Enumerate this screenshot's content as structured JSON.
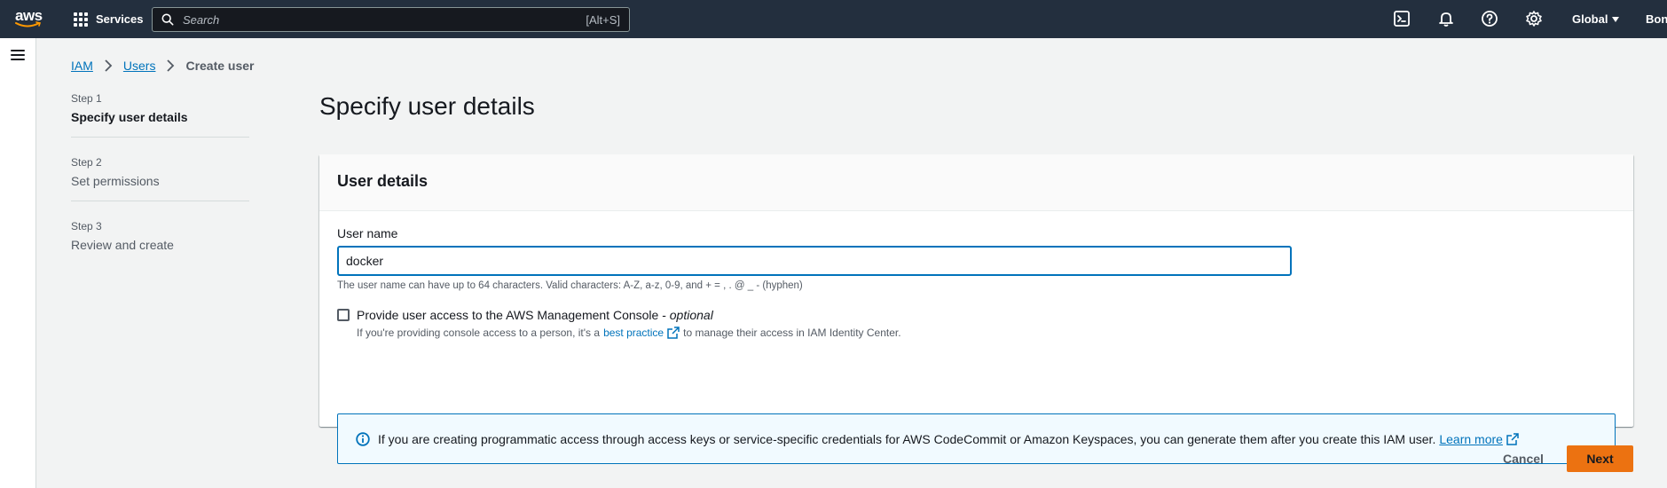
{
  "topnav": {
    "logo_text": "aws",
    "services_label": "Services",
    "search_placeholder": "Search",
    "search_shortcut": "[Alt+S]",
    "icons": [
      "cloudshell-icon",
      "notifications-icon",
      "help-icon",
      "settings-icon"
    ],
    "region_label": "Global",
    "account_label": "Bon"
  },
  "breadcrumb": {
    "items": [
      "IAM",
      "Users"
    ],
    "current": "Create user"
  },
  "steps": [
    {
      "label": "Step 1",
      "name": "Specify user details",
      "active": true
    },
    {
      "label": "Step 2",
      "name": "Set permissions",
      "active": false
    },
    {
      "label": "Step 3",
      "name": "Review and create",
      "active": false
    }
  ],
  "page_title": "Specify user details",
  "panel": {
    "title": "User details",
    "username_label": "User name",
    "username_value": "docker",
    "username_hint": "The user name can have up to 64 characters. Valid characters: A-Z, a-z, 0-9, and + = , . @ _ - (hyphen)",
    "console_access_label": "Provide user access to the AWS Management Console - ",
    "console_access_optional": "optional",
    "console_access_checked": false,
    "console_desc_prefix": "If you're providing console access to a person, it's a",
    "console_desc_link": "best practice",
    "console_desc_suffix": "to manage their access in IAM Identity Center.",
    "info_text": "If you are creating programmatic access through access keys or service-specific credentials for AWS CodeCommit or Amazon Keyspaces, you can generate them after you create this IAM user.",
    "info_link": "Learn more"
  },
  "actions": {
    "cancel_label": "Cancel",
    "next_label": "Next"
  },
  "colors": {
    "nav_bg": "#232f3e",
    "link": "#0073bb",
    "primary_button": "#ec7211",
    "page_bg": "#f2f3f3"
  }
}
